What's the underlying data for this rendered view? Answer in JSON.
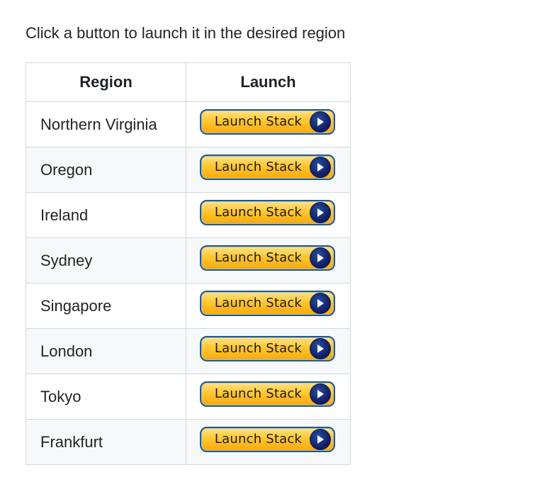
{
  "intro_text": "Click a button to launch it in the desired region",
  "table": {
    "headers": {
      "region": "Region",
      "launch": "Launch"
    },
    "rows": [
      {
        "region": "Northern Virginia",
        "button_label": "Launch Stack"
      },
      {
        "region": "Oregon",
        "button_label": "Launch Stack"
      },
      {
        "region": "Ireland",
        "button_label": "Launch Stack"
      },
      {
        "region": "Sydney",
        "button_label": "Launch Stack"
      },
      {
        "region": "Singapore",
        "button_label": "Launch Stack"
      },
      {
        "region": "London",
        "button_label": "Launch Stack"
      },
      {
        "region": "Tokyo",
        "button_label": "Launch Stack"
      },
      {
        "region": "Frankfurt",
        "button_label": "Launch Stack"
      }
    ]
  },
  "icons": {
    "button_icon": "play-circle-icon"
  },
  "colors": {
    "button_top": "#ffe38a",
    "button_bottom": "#f9a80a",
    "button_border": "#2b5878",
    "icon_circle": "#10226a",
    "row_stripe": "#f6f8fa",
    "table_border": "#d1d9e0"
  }
}
